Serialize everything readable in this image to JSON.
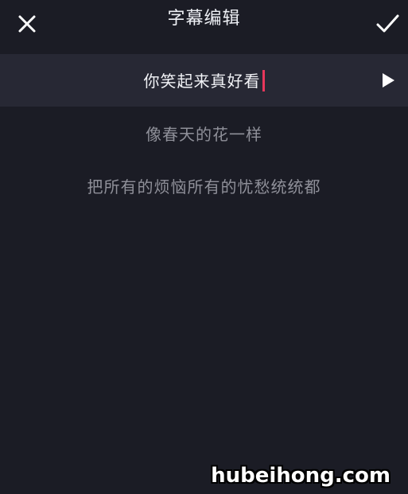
{
  "header": {
    "title": "字幕编辑",
    "close_icon": "close-icon",
    "confirm_icon": "checkmark-icon"
  },
  "subtitles": [
    {
      "text": "你笑起来真好看",
      "active": true
    },
    {
      "text": "像春天的花一样",
      "active": false
    },
    {
      "text": "把所有的烦恼所有的忧愁统统都",
      "active": false
    }
  ],
  "play_icon": "play-icon",
  "watermark": "hubeihong.com",
  "colors": {
    "background": "#1b1c25",
    "active_row": "#272834",
    "caret": "#e8375b",
    "inactive_text": "#8f9099"
  }
}
